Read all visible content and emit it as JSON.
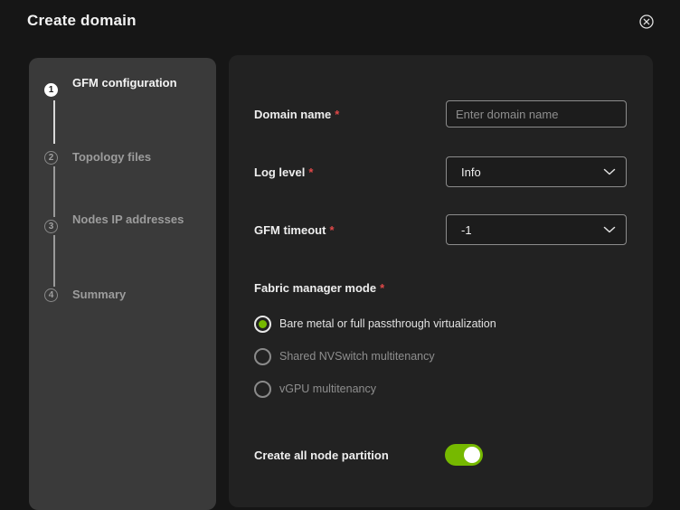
{
  "dialog": {
    "title": "Create domain",
    "close_icon": "close-circle-icon"
  },
  "steps": [
    {
      "number": "1",
      "label": "GFM configuration",
      "active": true
    },
    {
      "number": "2",
      "label": "Topology files",
      "active": false
    },
    {
      "number": "3",
      "label": "Nodes IP addresses",
      "active": false
    },
    {
      "number": "4",
      "label": "Summary",
      "active": false
    }
  ],
  "form": {
    "domain_name": {
      "label": "Domain name",
      "required": "*",
      "value": "",
      "placeholder": "Enter domain name"
    },
    "log_level": {
      "label": "Log level",
      "required": "*",
      "value": "Info"
    },
    "gfm_timeout": {
      "label": "GFM timeout",
      "required": "*",
      "value": "-1"
    },
    "fabric_manager_mode": {
      "label": "Fabric manager mode",
      "required": "*",
      "options": [
        {
          "label": "Bare metal or full passthrough virtualization",
          "selected": true
        },
        {
          "label": "Shared NVSwitch multitenancy",
          "selected": false
        },
        {
          "label": "vGPU multitenancy",
          "selected": false
        }
      ]
    },
    "create_all_node_partition": {
      "label": "Create all node partition",
      "enabled": true
    }
  },
  "colors": {
    "accent": "#76b900",
    "required": "#e04848",
    "background": "#161616",
    "panel": "#222222",
    "stepper": "#3a3a3a"
  }
}
